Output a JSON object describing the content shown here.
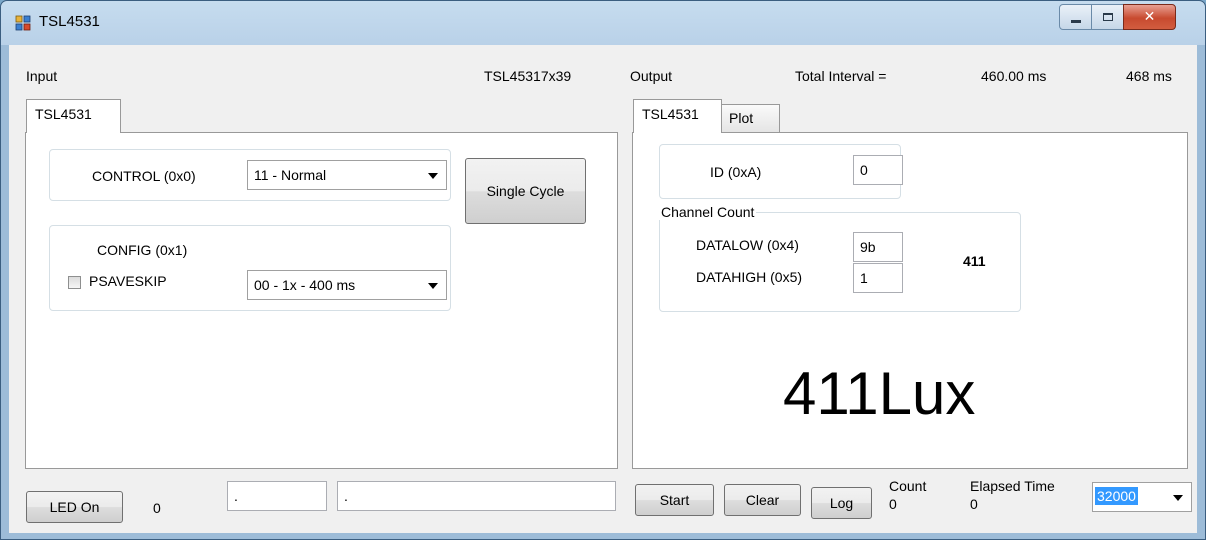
{
  "window": {
    "title": "TSL4531"
  },
  "input": {
    "label": "Input",
    "device_info": "TSL45317x39",
    "tab": "TSL4531",
    "control": {
      "label": "CONTROL (0x0)",
      "value": "11 - Normal"
    },
    "single_cycle": "Single Cycle",
    "config": {
      "label": "CONFIG (0x1)",
      "checkbox_label": "PSAVESKIP",
      "value": "00 - 1x - 400 ms"
    }
  },
  "output": {
    "label": "Output",
    "total_interval_label": "Total Interval =",
    "total_interval_value": "460.00 ms",
    "interval_actual": "468 ms",
    "tabs": [
      "TSL4531",
      "Plot"
    ],
    "id": {
      "label": "ID (0xA)",
      "value": "0"
    },
    "channel_count": {
      "title": "Channel Count",
      "datalow_label": "DATALOW (0x4)",
      "datalow_value": "9b",
      "datahigh_label": "DATAHIGH (0x5)",
      "datahigh_value": "1",
      "total": "411"
    },
    "lux_display": "411Lux"
  },
  "bottom": {
    "led_button": "LED On",
    "led_value": "0",
    "field1": ".",
    "field2": ".",
    "start": "Start",
    "clear": "Clear",
    "log": "Log",
    "count_label": "Count",
    "count_value": "0",
    "elapsed_label": "Elapsed Time",
    "elapsed_value": "0",
    "rate_value": "32000"
  }
}
